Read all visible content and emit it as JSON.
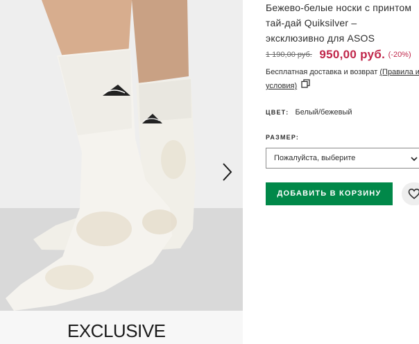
{
  "product": {
    "title_lines": [
      "Бежево-белые носки с принтом",
      "тай-дай Quiksilver –",
      "эксклюзивно для ASOS"
    ],
    "old_price": "1 190,00 руб.",
    "price": "950,00 руб.",
    "discount": "(-20%)",
    "delivery_text": "Бесплатная доставка и возврат",
    "delivery_link": "(Правила и",
    "delivery_link_2": "условия)",
    "color_label": "ЦВЕТ:",
    "color_value": "Белый/бежевый",
    "size_label": "РАЗМЕР:",
    "size_select_value": "Пожалуйста, выберите",
    "add_to_bag_label": "ДОБАВИТЬ В КОРЗИНУ"
  },
  "gallery": {
    "exclusive_label": "EXCLUSIVE",
    "next_icon": "chevron-right-icon"
  },
  "colors": {
    "price_red": "#c0264a",
    "button_green": "#018849"
  }
}
